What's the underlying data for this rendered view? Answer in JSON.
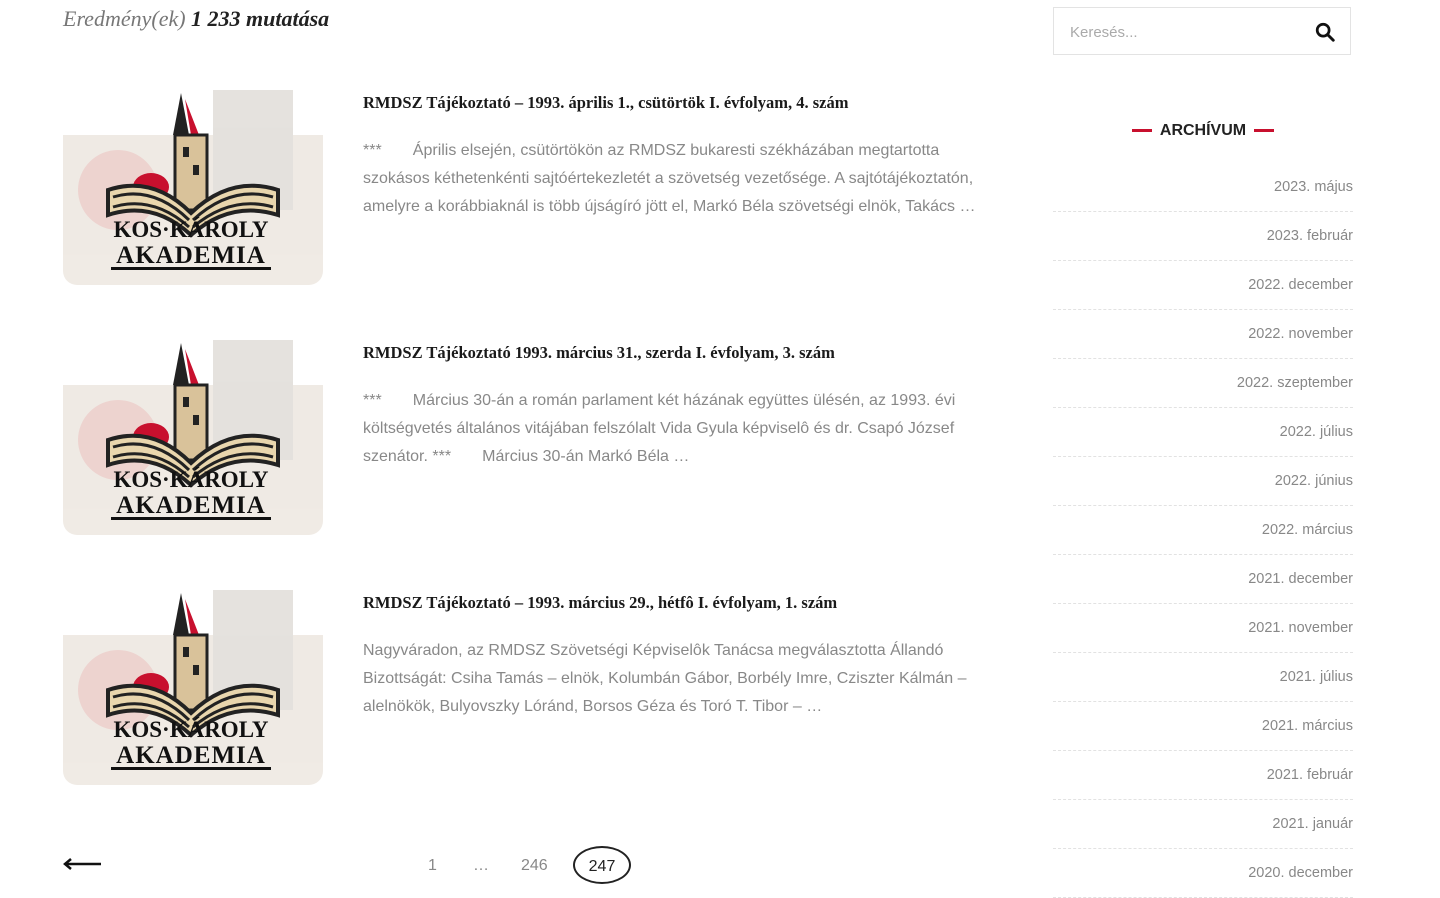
{
  "results": {
    "prefix": "Eredmény(ek)",
    "count": "1 233 mutatása"
  },
  "posts": [
    {
      "title": "RMDSZ Tájékoztató – 1993. április 1., csütörtök I. évfolyam, 4. szám",
      "excerpt": "***       Április elsején, csütörtökön az RMDSZ bukaresti székházában megtartotta szokásos kéthetenkénti sajtóértekezletét a szövetség vezetősége. A sajtótájékoztatón, amelyre a korábbiaknál is több újságíró jött el, Markó Béla szövetségi elnök, Takács …"
    },
    {
      "title": "RMDSZ Tájékoztató 1993. március 31., szerda I. évfolyam, 3. szám",
      "excerpt": "***       Március 30-án a román parlament két házának együttes ülésén, az 1993. évi költségvetés általános vitájában felszólalt Vida Gyula képviselô és dr. Csapó József szenátor. ***       Március 30-án Markó Béla …"
    },
    {
      "title": "RMDSZ Tájékoztató – 1993. március 29., hétfô I. évfolyam, 1. szám",
      "excerpt": "Nagyváradon, az RMDSZ Szövetségi Képviselôk Tanácsa megválasztotta Állandó Bizottságát: Csiha Tamás – elnök, Kolumbán Gábor, Borbély Imre, Cziszter Kálmán – alelnökök, Bulyovszky Lóránd, Borsos Géza és Toró T. Tibor – …"
    }
  ],
  "thumbnail": {
    "line1": "KOS·KÁROLY",
    "line2": "AKADEMIA"
  },
  "search": {
    "placeholder": "Keresés..."
  },
  "archive": {
    "title": "ARCHÍVUM",
    "items": [
      "2023. május",
      "2023. február",
      "2022. december",
      "2022. november",
      "2022. szeptember",
      "2022. július",
      "2022. június",
      "2022. március",
      "2021. december",
      "2021. november",
      "2021. július",
      "2021. március",
      "2021. február",
      "2021. január",
      "2020. december"
    ]
  },
  "pagination": {
    "pages": [
      "1",
      "…",
      "246"
    ],
    "current": "247"
  },
  "colors": {
    "accent": "#c8102e",
    "text": "#222222",
    "muted": "#888888"
  }
}
